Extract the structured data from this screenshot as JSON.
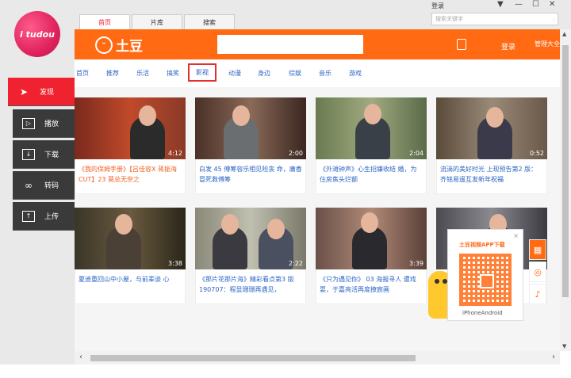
{
  "app": {
    "logo_text": "i tudou"
  },
  "sidebar": {
    "items": [
      {
        "label": "发现",
        "icon": "send-icon"
      },
      {
        "label": "播放",
        "icon": "play-icon"
      },
      {
        "label": "下载",
        "icon": "download-icon"
      },
      {
        "label": "转码",
        "icon": "infinity-icon"
      },
      {
        "label": "上传",
        "icon": "upload-icon"
      }
    ]
  },
  "topbar": {
    "tabs": [
      "首页",
      "片库",
      "搜索"
    ],
    "login": "登录",
    "search_placeholder": "搜索关键字"
  },
  "header": {
    "brand": "土豆",
    "login": "登录",
    "manage": "管理大全"
  },
  "nav": [
    "首页",
    "推荐",
    "乐活",
    "搞笑",
    "影视",
    "动漫",
    "身边",
    "综娱",
    "音乐",
    "游戏"
  ],
  "videos": [
    {
      "duration": "4:12",
      "caption": "《我的保姆手册》【吕佳容X 蒋振海 CUT】23 莫总无奈之"
    },
    {
      "duration": "2:00",
      "caption": "白发 45 傅筹容乐相见险丧 命，庸香冒死救傅筹"
    },
    {
      "duration": "2:04",
      "caption": "《外滩钟声》心生招嫌收结 婚，为住房焦头烂额"
    },
    {
      "duration": "0:52",
      "caption": "流淌的美好时光 上现预告第2 版：齐铭易遥互发新年祝福"
    },
    {
      "duration": "3:38",
      "caption": "夏迪重回山中小屋，与前辈谈 心"
    },
    {
      "duration": "2:22",
      "caption": "《那片花那片海》精彩看点第3 版190707：程显珊珊再遇见，"
    },
    {
      "duration": "3:39",
      "caption": "《只为遇见你》 03 海报寻人 遭戏耍，于嘉亮活再度撩宸画"
    },
    {
      "duration": "",
      "caption": ""
    }
  ],
  "qr": {
    "title": "土豆视频APP下载",
    "platforms": "iPhoneAndroid",
    "close": "×"
  }
}
